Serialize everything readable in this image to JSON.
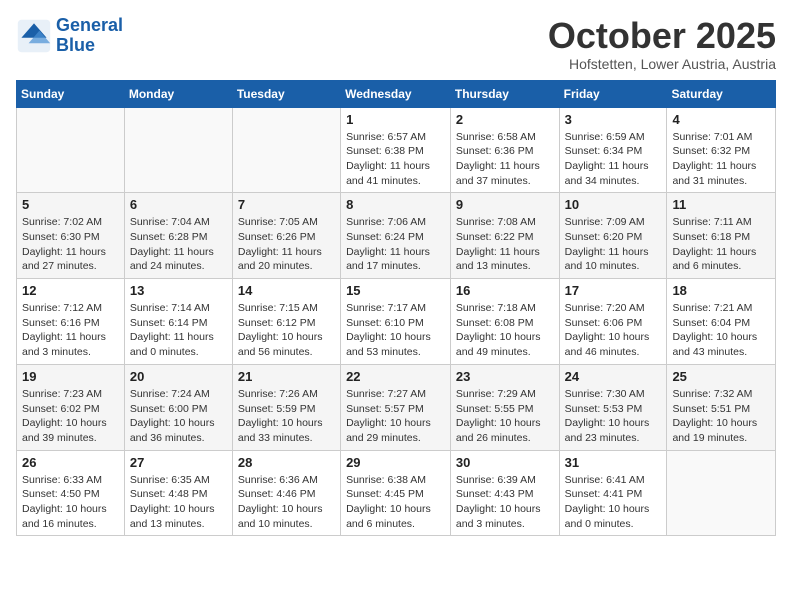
{
  "header": {
    "logo_line1": "General",
    "logo_line2": "Blue",
    "month": "October 2025",
    "location": "Hofstetten, Lower Austria, Austria"
  },
  "weekdays": [
    "Sunday",
    "Monday",
    "Tuesday",
    "Wednesday",
    "Thursday",
    "Friday",
    "Saturday"
  ],
  "weeks": [
    [
      {
        "day": "",
        "info": ""
      },
      {
        "day": "",
        "info": ""
      },
      {
        "day": "",
        "info": ""
      },
      {
        "day": "1",
        "info": "Sunrise: 6:57 AM\nSunset: 6:38 PM\nDaylight: 11 hours and 41 minutes."
      },
      {
        "day": "2",
        "info": "Sunrise: 6:58 AM\nSunset: 6:36 PM\nDaylight: 11 hours and 37 minutes."
      },
      {
        "day": "3",
        "info": "Sunrise: 6:59 AM\nSunset: 6:34 PM\nDaylight: 11 hours and 34 minutes."
      },
      {
        "day": "4",
        "info": "Sunrise: 7:01 AM\nSunset: 6:32 PM\nDaylight: 11 hours and 31 minutes."
      }
    ],
    [
      {
        "day": "5",
        "info": "Sunrise: 7:02 AM\nSunset: 6:30 PM\nDaylight: 11 hours and 27 minutes."
      },
      {
        "day": "6",
        "info": "Sunrise: 7:04 AM\nSunset: 6:28 PM\nDaylight: 11 hours and 24 minutes."
      },
      {
        "day": "7",
        "info": "Sunrise: 7:05 AM\nSunset: 6:26 PM\nDaylight: 11 hours and 20 minutes."
      },
      {
        "day": "8",
        "info": "Sunrise: 7:06 AM\nSunset: 6:24 PM\nDaylight: 11 hours and 17 minutes."
      },
      {
        "day": "9",
        "info": "Sunrise: 7:08 AM\nSunset: 6:22 PM\nDaylight: 11 hours and 13 minutes."
      },
      {
        "day": "10",
        "info": "Sunrise: 7:09 AM\nSunset: 6:20 PM\nDaylight: 11 hours and 10 minutes."
      },
      {
        "day": "11",
        "info": "Sunrise: 7:11 AM\nSunset: 6:18 PM\nDaylight: 11 hours and 6 minutes."
      }
    ],
    [
      {
        "day": "12",
        "info": "Sunrise: 7:12 AM\nSunset: 6:16 PM\nDaylight: 11 hours and 3 minutes."
      },
      {
        "day": "13",
        "info": "Sunrise: 7:14 AM\nSunset: 6:14 PM\nDaylight: 11 hours and 0 minutes."
      },
      {
        "day": "14",
        "info": "Sunrise: 7:15 AM\nSunset: 6:12 PM\nDaylight: 10 hours and 56 minutes."
      },
      {
        "day": "15",
        "info": "Sunrise: 7:17 AM\nSunset: 6:10 PM\nDaylight: 10 hours and 53 minutes."
      },
      {
        "day": "16",
        "info": "Sunrise: 7:18 AM\nSunset: 6:08 PM\nDaylight: 10 hours and 49 minutes."
      },
      {
        "day": "17",
        "info": "Sunrise: 7:20 AM\nSunset: 6:06 PM\nDaylight: 10 hours and 46 minutes."
      },
      {
        "day": "18",
        "info": "Sunrise: 7:21 AM\nSunset: 6:04 PM\nDaylight: 10 hours and 43 minutes."
      }
    ],
    [
      {
        "day": "19",
        "info": "Sunrise: 7:23 AM\nSunset: 6:02 PM\nDaylight: 10 hours and 39 minutes."
      },
      {
        "day": "20",
        "info": "Sunrise: 7:24 AM\nSunset: 6:00 PM\nDaylight: 10 hours and 36 minutes."
      },
      {
        "day": "21",
        "info": "Sunrise: 7:26 AM\nSunset: 5:59 PM\nDaylight: 10 hours and 33 minutes."
      },
      {
        "day": "22",
        "info": "Sunrise: 7:27 AM\nSunset: 5:57 PM\nDaylight: 10 hours and 29 minutes."
      },
      {
        "day": "23",
        "info": "Sunrise: 7:29 AM\nSunset: 5:55 PM\nDaylight: 10 hours and 26 minutes."
      },
      {
        "day": "24",
        "info": "Sunrise: 7:30 AM\nSunset: 5:53 PM\nDaylight: 10 hours and 23 minutes."
      },
      {
        "day": "25",
        "info": "Sunrise: 7:32 AM\nSunset: 5:51 PM\nDaylight: 10 hours and 19 minutes."
      }
    ],
    [
      {
        "day": "26",
        "info": "Sunrise: 6:33 AM\nSunset: 4:50 PM\nDaylight: 10 hours and 16 minutes."
      },
      {
        "day": "27",
        "info": "Sunrise: 6:35 AM\nSunset: 4:48 PM\nDaylight: 10 hours and 13 minutes."
      },
      {
        "day": "28",
        "info": "Sunrise: 6:36 AM\nSunset: 4:46 PM\nDaylight: 10 hours and 10 minutes."
      },
      {
        "day": "29",
        "info": "Sunrise: 6:38 AM\nSunset: 4:45 PM\nDaylight: 10 hours and 6 minutes."
      },
      {
        "day": "30",
        "info": "Sunrise: 6:39 AM\nSunset: 4:43 PM\nDaylight: 10 hours and 3 minutes."
      },
      {
        "day": "31",
        "info": "Sunrise: 6:41 AM\nSunset: 4:41 PM\nDaylight: 10 hours and 0 minutes."
      },
      {
        "day": "",
        "info": ""
      }
    ]
  ]
}
